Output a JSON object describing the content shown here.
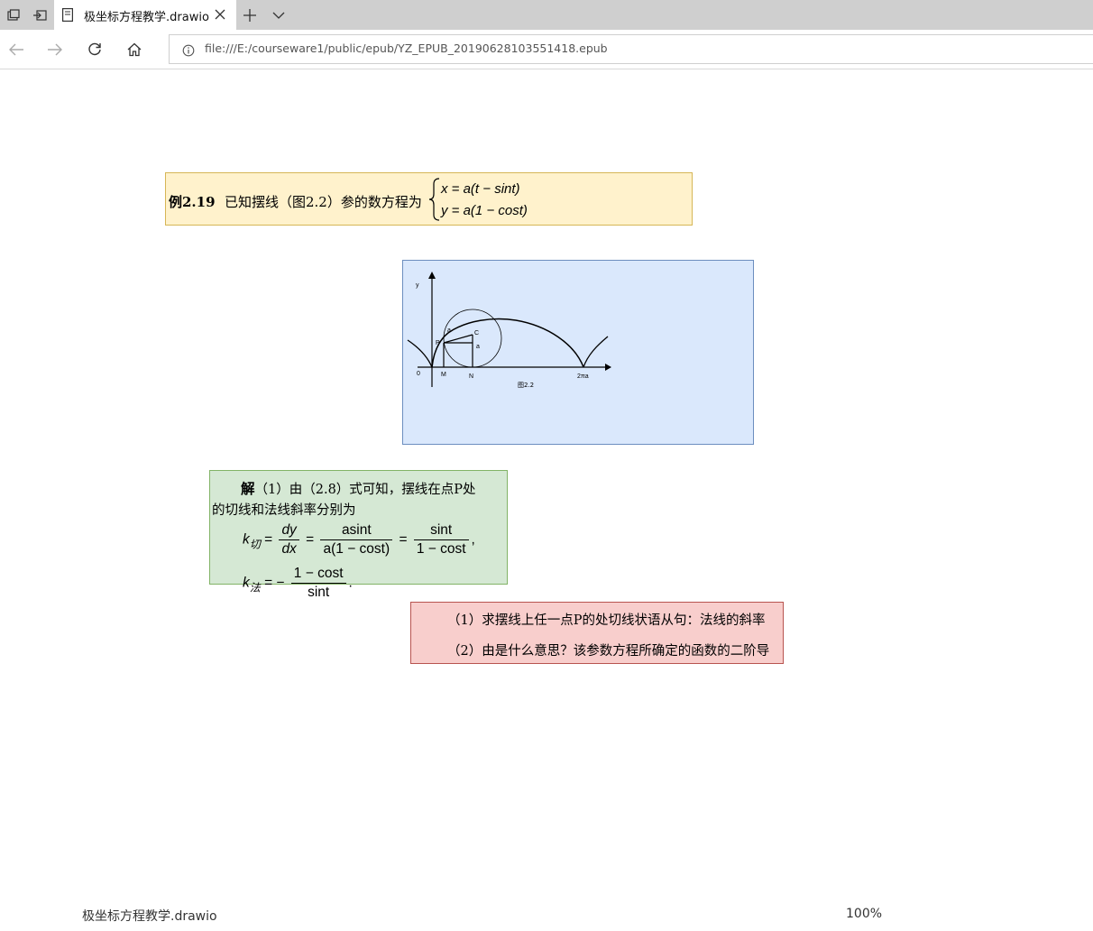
{
  "browser": {
    "tab_title": "极坐标方程教学.drawio",
    "url": "file:///E:/courseware1/public/epub/YZ_EPUB_20190628103551418.epub"
  },
  "example": {
    "label": "例2.19",
    "text": "已知摆线（图2.2）参的数方程为",
    "eq1": "x = a(t − sint)",
    "eq2": "y = a(1 − cost)"
  },
  "figure": {
    "y_label": "y",
    "origin_label": "0",
    "labels": [
      "P",
      "a",
      "C",
      "a",
      "M",
      "N",
      "2πa"
    ],
    "caption": "图2.2"
  },
  "solution": {
    "bold": "解",
    "line1": "（1）由（2.8）式可知，摆线在点P处",
    "line2": "的切线和法线斜率分别为",
    "k_tan_sub": "切",
    "k_norm_sub": "法",
    "f1_num": "dy",
    "f1_den": "dx",
    "f2_num": "asint",
    "f2_den": "a(1 − cost)",
    "f3_num": "sint",
    "f3_den": "1 − cost",
    "f4_num": "1 − cost",
    "f4_den": "sint"
  },
  "questions": {
    "q1": "（1）求摆线上任一点P的处切线状语从句：法线的斜率",
    "q2": "（2）由是什么意思？该参数方程所确定的函数的二阶导"
  },
  "status": {
    "filename": "极坐标方程教学.drawio",
    "zoom": "100%"
  }
}
